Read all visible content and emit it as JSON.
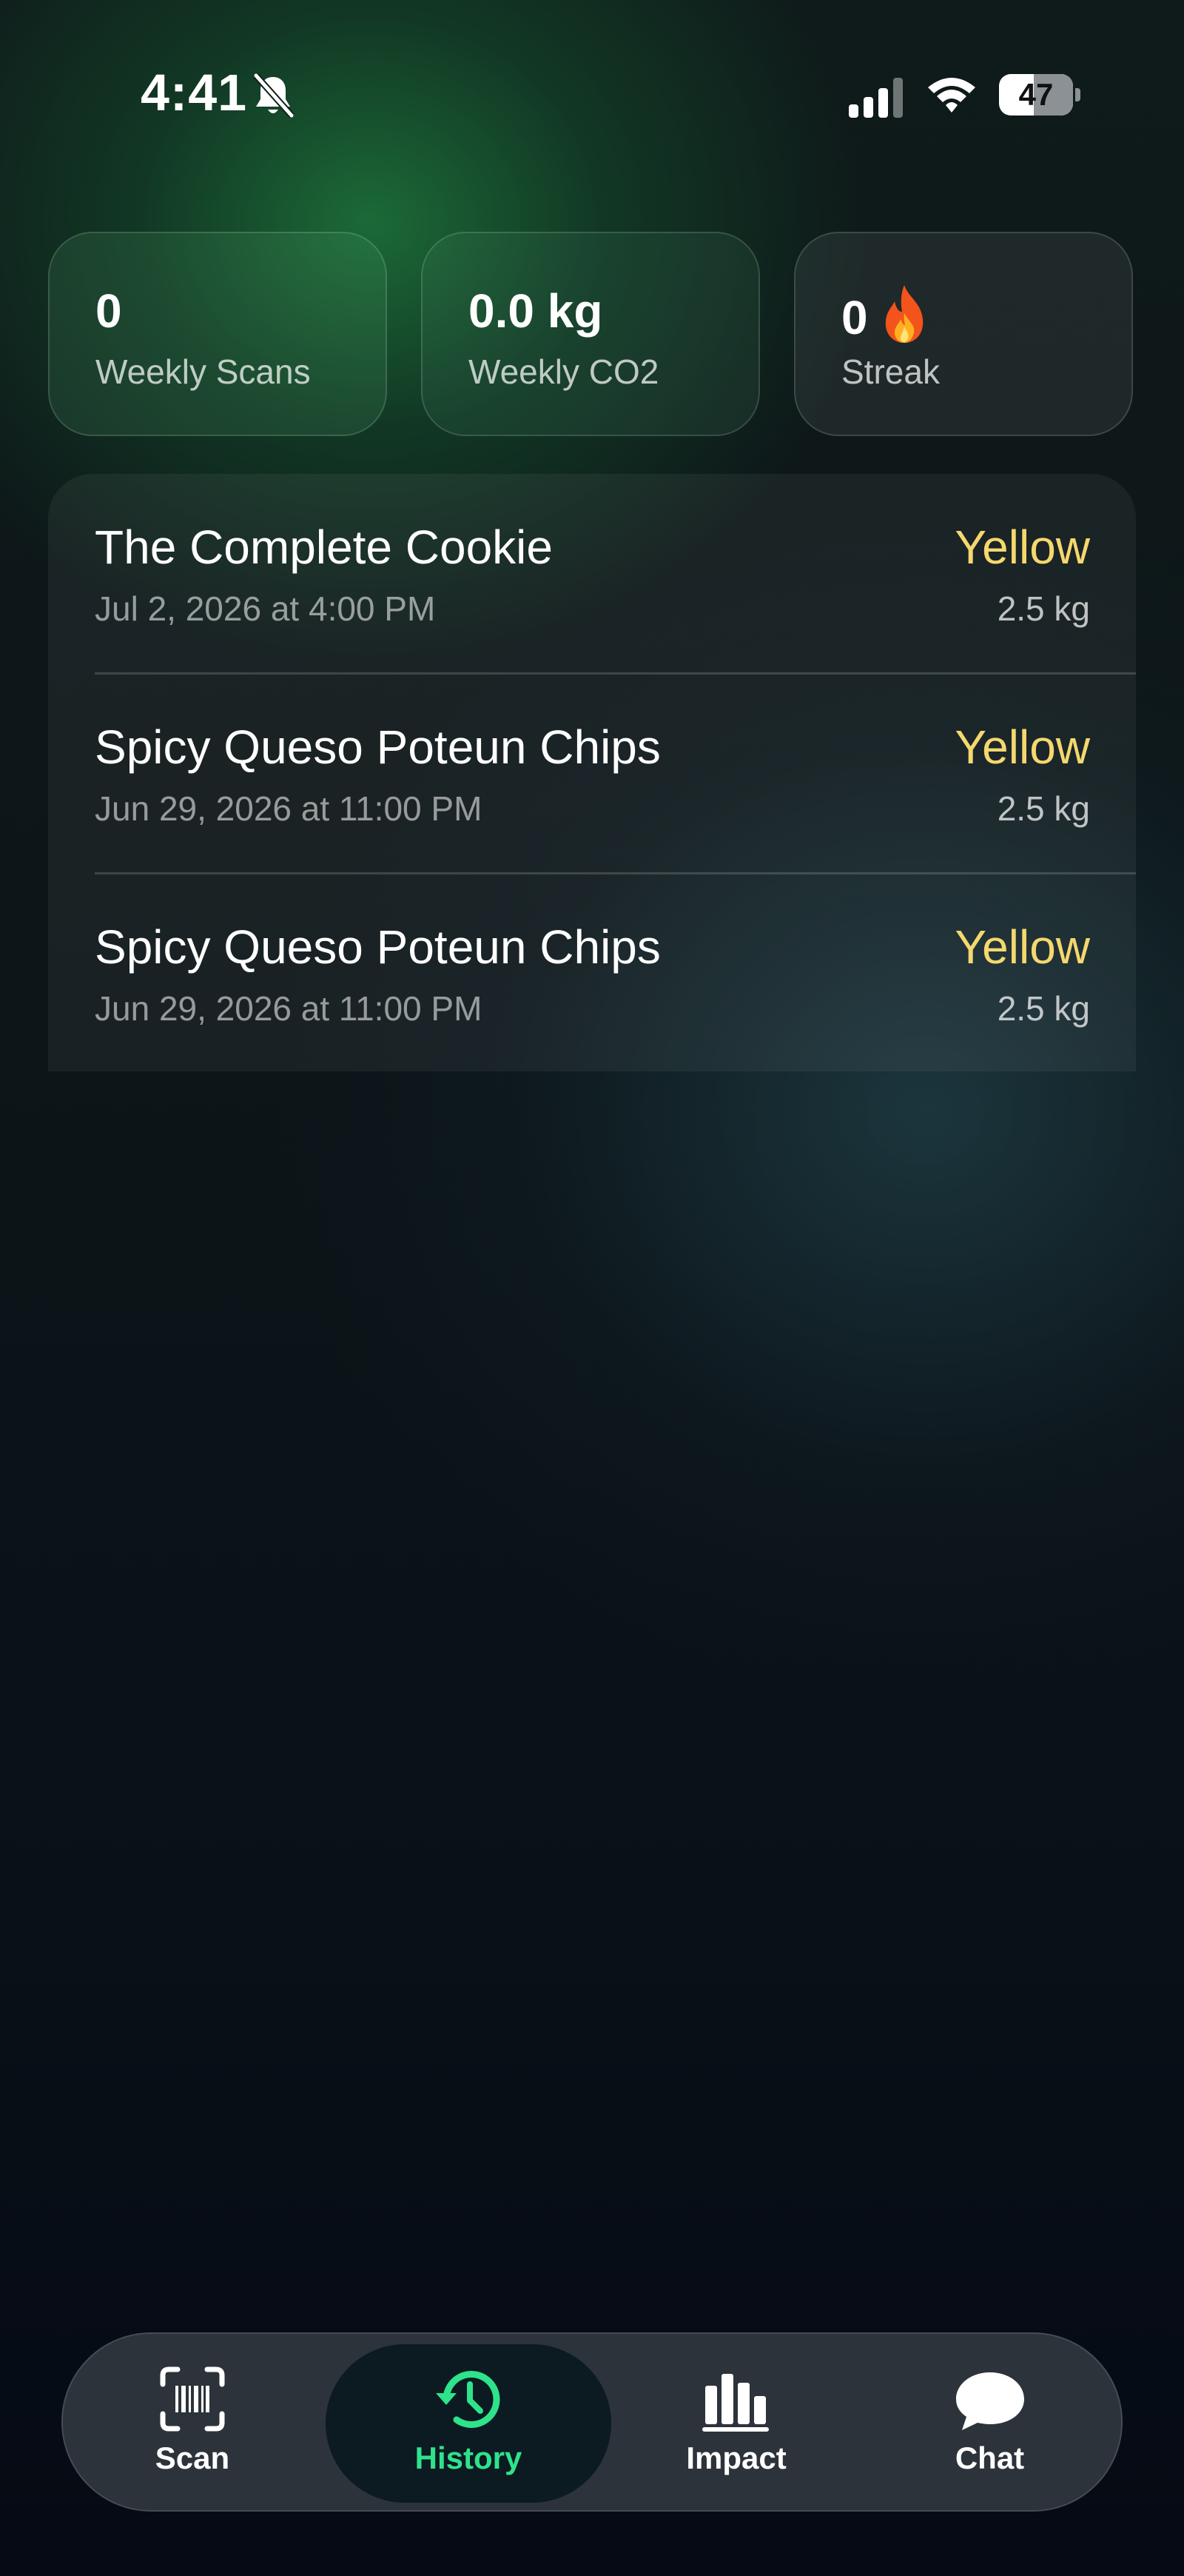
{
  "status_bar": {
    "time": "4:41",
    "battery_level": "47",
    "battery_fraction": 0.47,
    "icons": [
      "bell-slash-icon",
      "signal-icon",
      "wifi-icon",
      "battery-icon"
    ]
  },
  "stats": [
    {
      "value": "0",
      "label": "Weekly Scans"
    },
    {
      "value": "0.0 kg",
      "label": "Weekly CO2"
    },
    {
      "value": "0",
      "label": "Streak",
      "icon": "flame-icon"
    }
  ],
  "history": {
    "items": [
      {
        "name": "The Complete Cookie",
        "date": "Jul 2, 2026 at 4:00 PM",
        "rating": "Yellow",
        "co2": "2.5 kg"
      },
      {
        "name": "Spicy Queso Poteun Chips",
        "date": "Jun 29, 2026 at 11:00 PM",
        "rating": "Yellow",
        "co2": "2.5 kg"
      },
      {
        "name": "Spicy Queso Poteun Chips",
        "date": "Jun 29, 2026 at 11:00 PM",
        "rating": "Yellow",
        "co2": "2.5 kg"
      }
    ]
  },
  "tab_bar": {
    "active": "History",
    "tabs": [
      {
        "label": "Scan",
        "icon": "barcode-scan-icon"
      },
      {
        "label": "History",
        "icon": "history-clock-icon"
      },
      {
        "label": "Impact",
        "icon": "bar-chart-icon"
      },
      {
        "label": "Chat",
        "icon": "chat-bubble-icon"
      }
    ]
  },
  "colors": {
    "rating_yellow": "#f5d86e",
    "active_tab": "#2ee38a",
    "background": "#0a1118"
  }
}
